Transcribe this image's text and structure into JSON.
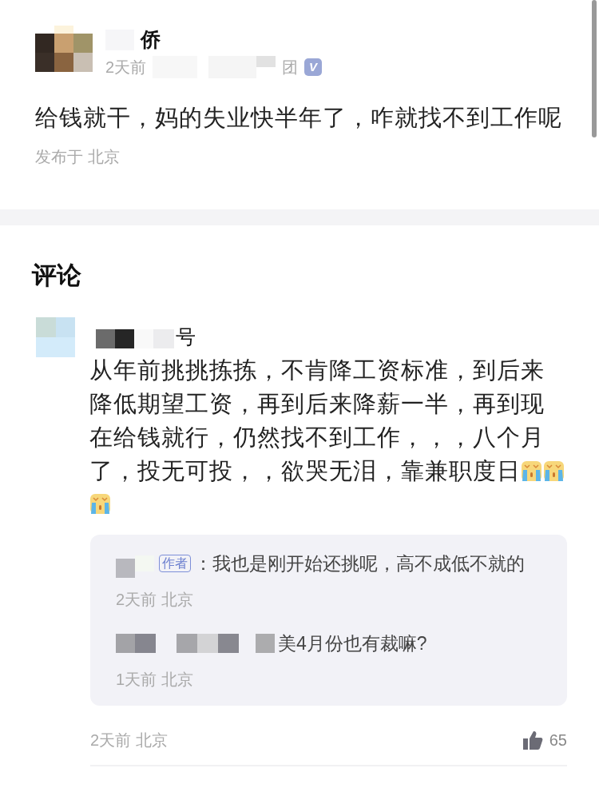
{
  "post": {
    "author_visible": "侨",
    "time": "2天前",
    "meta_tail": "团",
    "badge": "V",
    "text": "给钱就干，妈的失业快半年了，咋就找不到工作呢",
    "location": "发布于 北京"
  },
  "comments_heading": "评论",
  "comments": [
    {
      "author_visible": "号",
      "text_lines": [
        "从年前挑挑拣拣，不肯降工资标准，到后来",
        "降低期望工资，再到后来降薪一半，再到现",
        "在给钱就行，仍然找不到工作，，，八个月",
        "了，投无可投，，欲哭无泪，靠兼职度日"
      ],
      "emojis": [
        {
          "kind": "crying"
        },
        {
          "kind": "crying"
        },
        {
          "kind": "crying"
        }
      ],
      "replies": [
        {
          "author_badge": "作者",
          "text": "：我也是刚开始还挑呢，高不成低不就的",
          "meta": "2天前 北京"
        },
        {
          "text": "美4月份也有裁嘛?",
          "meta": "1天前 北京"
        }
      ],
      "meta": "2天前 北京",
      "likes": "65"
    }
  ]
}
